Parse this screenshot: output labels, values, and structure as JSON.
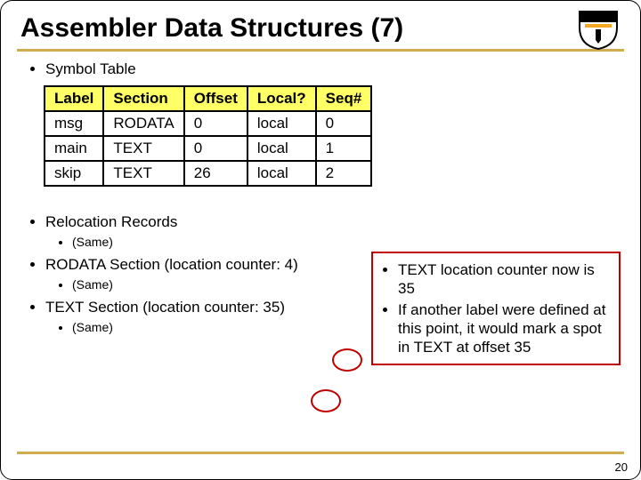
{
  "title": "Assembler Data Structures (7)",
  "page_number": "20",
  "bullets": {
    "symbol_table_label": "Symbol Table",
    "relocation_label": "Relocation Records",
    "same_label": "(Same)",
    "rodata_section_label": "RODATA Section (location counter: 4)",
    "text_section_label": "TEXT Section (location counter: 35)"
  },
  "table": {
    "headers": [
      "Label",
      "Section",
      "Offset",
      "Local?",
      "Seq#"
    ],
    "rows": [
      [
        "msg",
        "RODATA",
        "0",
        "local",
        "0"
      ],
      [
        "main",
        "TEXT",
        "0",
        "local",
        "1"
      ],
      [
        "skip",
        "TEXT",
        "26",
        "local",
        "2"
      ]
    ]
  },
  "callout": {
    "line1": "TEXT location counter now is 35",
    "line2": "If another label were defined at this point, it would mark a spot in TEXT at offset 35"
  }
}
